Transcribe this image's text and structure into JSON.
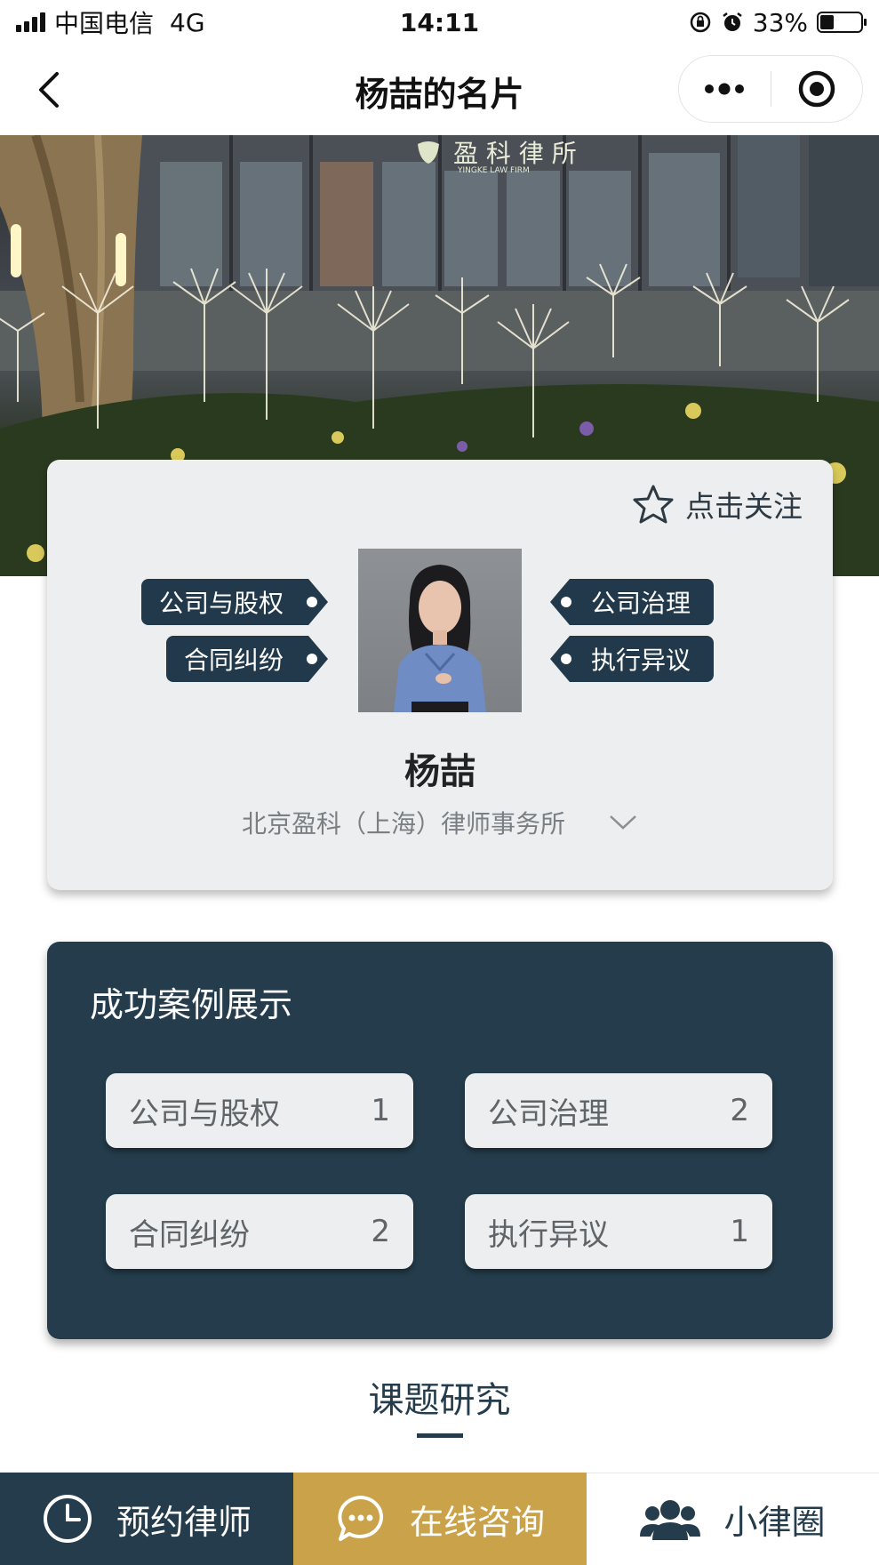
{
  "status_bar": {
    "carrier": "中国电信",
    "network": "4G",
    "time": "14:11",
    "battery": "33%",
    "battery_level": 0.33
  },
  "nav": {
    "title": "杨喆的名片",
    "back_icon": "chevron-left-icon",
    "more_icon": "more-dots-icon",
    "close_icon": "target-circle-icon"
  },
  "hero": {
    "sign_text": "盈 科 律 所",
    "sign_subtext": "YINGKE LAW FIRM"
  },
  "profile": {
    "follow_label": "点击关注",
    "follow_icon": "star-icon",
    "tags_left": [
      "公司与股权",
      "合同纠纷"
    ],
    "tags_right": [
      "公司治理",
      "执行异议"
    ],
    "name": "杨喆",
    "firm": "北京盈科（上海）律师事务所",
    "expand_icon": "chevron-down-icon"
  },
  "cases": {
    "title": "成功案例展示",
    "items": [
      {
        "label": "公司与股权",
        "count": "1"
      },
      {
        "label": "公司治理",
        "count": "2"
      },
      {
        "label": "合同纠纷",
        "count": "2"
      },
      {
        "label": "执行异议",
        "count": "1"
      }
    ]
  },
  "section_tab": {
    "label": "课题研究"
  },
  "bottom_bar": {
    "appoint_label": "预约律师",
    "consult_label": "在线咨询",
    "circle_label": "小律圈"
  },
  "colors": {
    "primary": "#243c4b",
    "gold": "#c9a24a",
    "card_bg": "#eceeef"
  }
}
